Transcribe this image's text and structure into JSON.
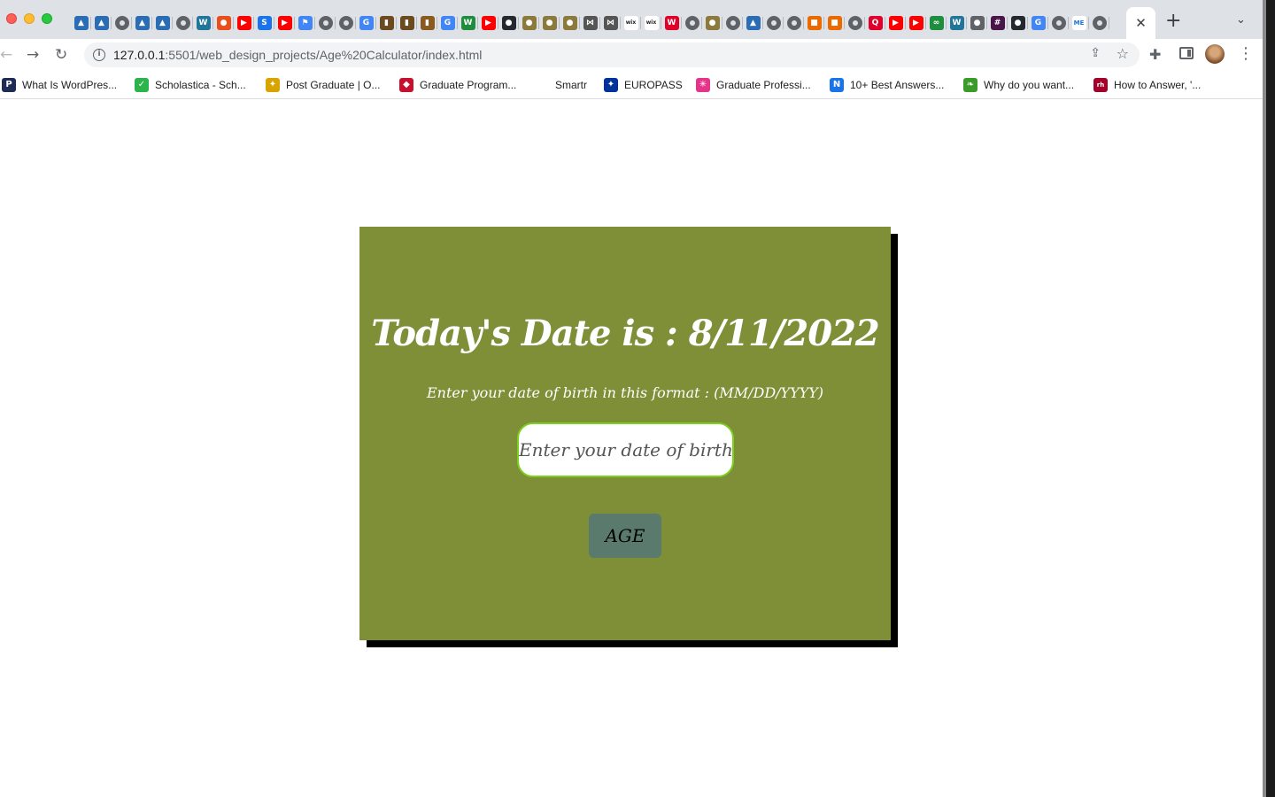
{
  "browser": {
    "new_tab_label": "+",
    "active_tab_close": "✕",
    "tab_search_icon": "chevron-down-icon",
    "address": {
      "host": "127.0.0.1",
      "path": ":5501/web_design_projects/Age%20Calculator/index.html"
    },
    "favicons": [
      {
        "icon": "pen-icon",
        "color": "#2a6db5",
        "text": "▲"
      },
      {
        "icon": "pen-icon",
        "color": "#2a6db5",
        "text": "▲"
      },
      {
        "icon": "globe-icon",
        "color": "#5f6368",
        "text": ""
      },
      {
        "icon": "pen-icon",
        "color": "#2a6db5",
        "text": "▲"
      },
      {
        "icon": "pen-icon",
        "color": "#2a6db5",
        "text": "▲"
      },
      {
        "icon": "globe-icon",
        "color": "#5f6368",
        "text": ""
      },
      {
        "icon": "wordpress-icon",
        "color": "#21759b",
        "text": "W"
      },
      {
        "icon": "drop-icon",
        "color": "#e94e1b",
        "text": "●"
      },
      {
        "icon": "youtube-icon",
        "color": "#ff0000",
        "text": "▶"
      },
      {
        "icon": "s-icon",
        "color": "#1a73e8",
        "text": "S"
      },
      {
        "icon": "youtube-icon",
        "color": "#ff0000",
        "text": "▶"
      },
      {
        "icon": "flag-icon",
        "color": "#4285f4",
        "text": "⚑"
      },
      {
        "icon": "globe-icon",
        "color": "#5f6368",
        "text": ""
      },
      {
        "icon": "globe-icon",
        "color": "#5f6368",
        "text": ""
      },
      {
        "icon": "google-icon",
        "color": "#4285f4",
        "text": "G"
      },
      {
        "icon": "book-icon",
        "color": "#6b4a1f",
        "text": "▮"
      },
      {
        "icon": "book-icon",
        "color": "#6b4a1f",
        "text": "▮"
      },
      {
        "icon": "book-icon",
        "color": "#8a5a1f",
        "text": "▮"
      },
      {
        "icon": "google-icon",
        "color": "#4285f4",
        "text": "G"
      },
      {
        "icon": "w-icon",
        "color": "#1e8e3e",
        "text": "W"
      },
      {
        "icon": "youtube-icon",
        "color": "#ff0000",
        "text": "▶"
      },
      {
        "icon": "github-icon",
        "color": "#24292f",
        "text": "●"
      },
      {
        "icon": "coin-icon",
        "color": "#8b7a3c",
        "text": "●"
      },
      {
        "icon": "coin-icon",
        "color": "#8b7a3c",
        "text": "●"
      },
      {
        "icon": "coin-icon",
        "color": "#8b7a3c",
        "text": "●"
      },
      {
        "icon": "arrows-icon",
        "color": "#555555",
        "text": "⋈"
      },
      {
        "icon": "arrows-icon",
        "color": "#555555",
        "text": "⋈"
      },
      {
        "icon": "wix-icon",
        "color": "#222222",
        "text": "wix"
      },
      {
        "icon": "wix-icon",
        "color": "#222222",
        "text": "wix"
      },
      {
        "icon": "w-red-icon",
        "color": "#e0002a",
        "text": "W"
      },
      {
        "icon": "globe-icon",
        "color": "#5f6368",
        "text": ""
      },
      {
        "icon": "coin-icon",
        "color": "#8b7a3c",
        "text": "●"
      },
      {
        "icon": "globe-icon",
        "color": "#5f6368",
        "text": ""
      },
      {
        "icon": "pen-icon",
        "color": "#2a6db5",
        "text": "▲"
      },
      {
        "icon": "globe-icon",
        "color": "#5f6368",
        "text": ""
      },
      {
        "icon": "globe-icon",
        "color": "#5f6368",
        "text": ""
      },
      {
        "icon": "squares-icon",
        "color": "#ea6a00",
        "text": "■"
      },
      {
        "icon": "squares-icon",
        "color": "#ea6a00",
        "text": "■"
      },
      {
        "icon": "globe-icon",
        "color": "#5f6368",
        "text": ""
      },
      {
        "icon": "q-icon",
        "color": "#e0002a",
        "text": "Q"
      },
      {
        "icon": "youtube-icon",
        "color": "#ff0000",
        "text": "▶"
      },
      {
        "icon": "youtube-icon",
        "color": "#ff0000",
        "text": "▶"
      },
      {
        "icon": "infinity-icon",
        "color": "#1e8e3e",
        "text": "∞"
      },
      {
        "icon": "wordpress-icon",
        "color": "#21759b",
        "text": "W"
      },
      {
        "icon": "chrome-icon",
        "color": "#5f6368",
        "text": "●"
      },
      {
        "icon": "slack-icon",
        "color": "#4a154b",
        "text": "#"
      },
      {
        "icon": "github-icon",
        "color": "#24292f",
        "text": "●"
      },
      {
        "icon": "google-icon",
        "color": "#4285f4",
        "text": "G"
      },
      {
        "icon": "globe-icon",
        "color": "#5f6368",
        "text": ""
      },
      {
        "icon": "me-icon",
        "color": "#1a73e8",
        "text": "ME"
      },
      {
        "icon": "globe-icon",
        "color": "#5f6368",
        "text": ""
      }
    ],
    "bookmarks": [
      {
        "label": "What Is WordPres...",
        "icon": "p-icon",
        "color": "#1d2b55",
        "glyph": "P"
      },
      {
        "label": "Scholastica - Sch...",
        "icon": "scholastica-icon",
        "color": "#2cb34a",
        "glyph": "✓"
      },
      {
        "label": "Post Graduate | O...",
        "icon": "pg-icon",
        "color": "#d9a400",
        "glyph": "✦"
      },
      {
        "label": "Graduate Program...",
        "icon": "shield-icon",
        "color": "#c8102e",
        "glyph": "◆"
      },
      {
        "label": "Smartr",
        "icon": "",
        "color": "",
        "glyph": ""
      },
      {
        "label": "EUROPASS",
        "icon": "eu-flag-icon",
        "color": "#003399",
        "glyph": "✦"
      },
      {
        "label": "Graduate Professi...",
        "icon": "sparkle-icon",
        "color": "#e4358a",
        "glyph": "✳"
      },
      {
        "label": "10+ Best Answers...",
        "icon": "n-icon",
        "color": "#1a73e8",
        "glyph": "N"
      },
      {
        "label": "Why do you want...",
        "icon": "leaf-icon",
        "color": "#3a9a2a",
        "glyph": "❧"
      },
      {
        "label": "How to Answer, '...",
        "icon": "rh-icon",
        "color": "#a3002a",
        "glyph": "rh"
      }
    ]
  },
  "page": {
    "title": "Today's Date is : 8/11/2022",
    "instruction": "Enter your date of birth in this format : (MM/DD/YYYY)",
    "dob_placeholder": "Enter your date of birth",
    "dob_value": "",
    "age_button": "AGE",
    "colors": {
      "card": "#7e8f37",
      "button": "#5a7a6e",
      "input_border": "#7bd11f"
    }
  }
}
